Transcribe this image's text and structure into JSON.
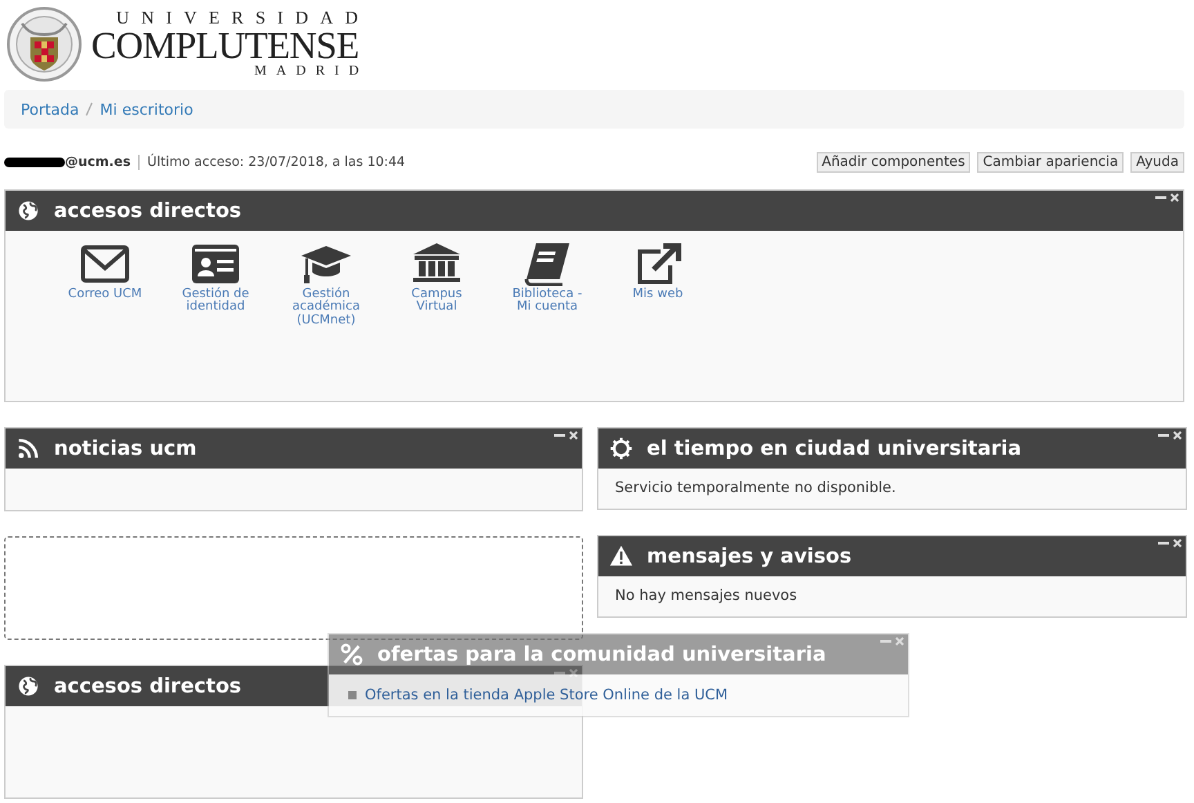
{
  "logo": {
    "line1": "UNIVERSIDAD",
    "line2": "COMPLUTENSE",
    "line3": "MADRID"
  },
  "breadcrumb": [
    {
      "label": "Portada"
    },
    {
      "label": "Mi escritorio"
    }
  ],
  "user": {
    "email": "@ucm.es",
    "last_access": "Último acceso: 23/07/2018, a las 10:44"
  },
  "buttons": [
    "Añadir componentes",
    "Cambiar apariencia",
    "Ayuda"
  ],
  "top_widget": {
    "title": "accesos directos",
    "shortcuts": [
      {
        "label": "Correo UCM"
      },
      {
        "label": "Gestión de identidad"
      },
      {
        "label": "Gestión académica (UCMnet)"
      },
      {
        "label": "Campus Virtual"
      },
      {
        "label": "Biblioteca - Mi cuenta"
      },
      {
        "label": "Mis web"
      }
    ]
  },
  "left_column": [
    {
      "kind": "widget",
      "title": "noticias ucm"
    },
    {
      "kind": "placeholder"
    },
    {
      "kind": "widget",
      "title": "accesos directos"
    }
  ],
  "right_column": [
    {
      "kind": "widget",
      "title": "el tiempo en ciudad universitaria",
      "text": "Servicio temporalmente no disponible."
    },
    {
      "kind": "widget",
      "title": "mensajes y avisos",
      "text": "No hay mensajes nuevos"
    }
  ],
  "dragged_widget": {
    "title": "ofertas para la comunidad universitaria",
    "link": "Ofertas en la tienda Apple Store Online de la UCM"
  }
}
